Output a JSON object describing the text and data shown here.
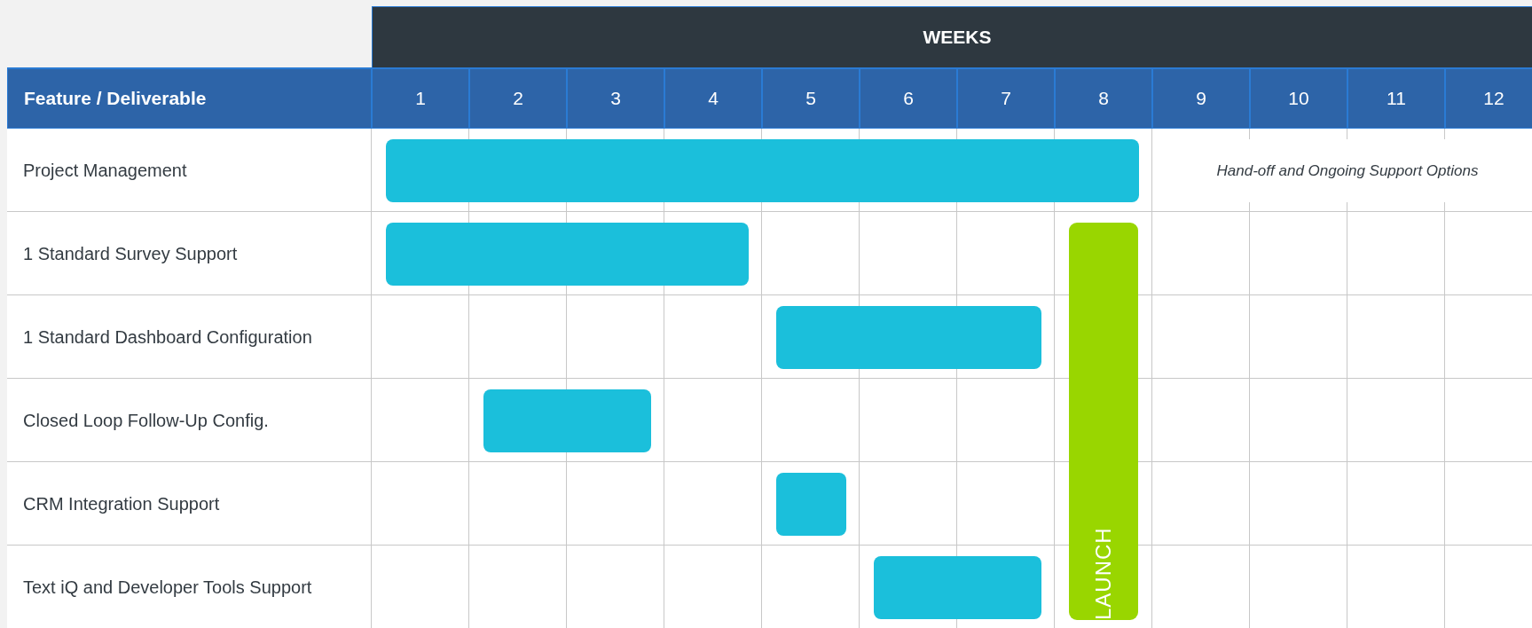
{
  "weeks_header": "WEEKS",
  "first_column": "Feature / Deliverable",
  "weeks": [
    {
      "label": "1",
      "launch": false
    },
    {
      "label": "2",
      "launch": false
    },
    {
      "label": "3",
      "launch": false
    },
    {
      "label": "4",
      "launch": false
    },
    {
      "label": "5",
      "launch": false
    },
    {
      "label": "6",
      "launch": false
    },
    {
      "label": "7",
      "launch": false
    },
    {
      "label": "8",
      "launch": true
    },
    {
      "label": "9",
      "launch": false
    },
    {
      "label": "10",
      "launch": false
    },
    {
      "label": "11",
      "launch": false
    },
    {
      "label": "12",
      "launch": false
    }
  ],
  "launch_label": "LAUNCH",
  "rows": [
    {
      "name": "Project Management",
      "launch": false,
      "active": [
        true,
        true,
        true,
        true,
        true,
        true,
        true,
        true,
        false,
        false,
        false,
        false
      ],
      "note": "Hand-off and Ongoing Support Options"
    },
    {
      "name": "1 Standard Survey Support",
      "launch": true,
      "active": [
        true,
        true,
        true,
        true,
        false,
        false,
        false,
        false,
        false,
        false,
        false,
        false
      ]
    },
    {
      "name": "1 Standard Dashboard Configuration",
      "launch": true,
      "active": [
        false,
        false,
        false,
        false,
        true,
        true,
        true,
        false,
        false,
        false,
        false,
        false
      ]
    },
    {
      "name": "Closed Loop Follow-Up Config.",
      "launch": true,
      "active": [
        false,
        true,
        true,
        false,
        false,
        false,
        false,
        false,
        false,
        false,
        false,
        false
      ]
    },
    {
      "name": "CRM Integration Support",
      "launch": true,
      "active": [
        false,
        false,
        false,
        false,
        true,
        false,
        false,
        false,
        false,
        false,
        false,
        false
      ]
    },
    {
      "name": "Text iQ and Developer Tools Support",
      "launch": true,
      "active": [
        false,
        false,
        false,
        false,
        false,
        true,
        true,
        false,
        false,
        false,
        false,
        false
      ]
    }
  ]
}
